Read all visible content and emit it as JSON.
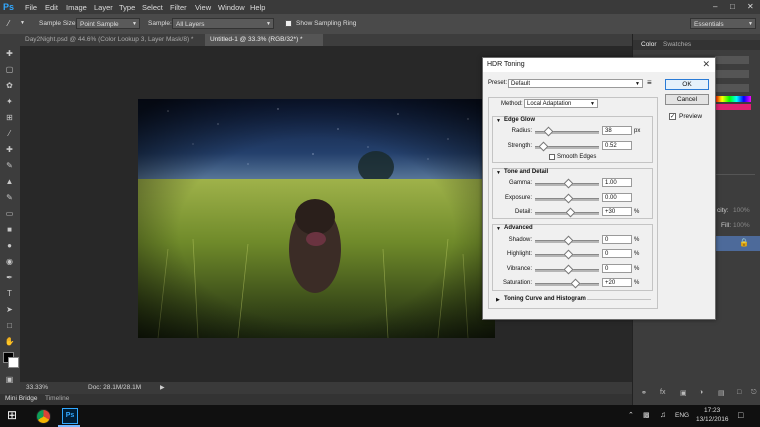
{
  "app": {
    "logo": "Ps",
    "menu": [
      "File",
      "Edit",
      "Image",
      "Layer",
      "Type",
      "Select",
      "Filter",
      "View",
      "Window",
      "Help"
    ]
  },
  "options": {
    "sample_size_label": "Sample Size:",
    "sample_size_value": "Point Sample",
    "sample_label": "Sample:",
    "sample_value": "All Layers",
    "show_ring_label": "Show Sampling Ring",
    "workspace": "Essentials"
  },
  "tabs": [
    "Day2Night.psd @ 44.6% (Color Lookup 3, Layer Mask/8) *",
    "Untitled-1 @ 33.3% (RGB/32*) *"
  ],
  "status": {
    "zoom": "33.33%",
    "doc": "Doc: 28.1M/28.1M"
  },
  "bottom_tabs": [
    "Mini Bridge",
    "Timeline"
  ],
  "panels": {
    "color_tab": "Color",
    "swatches_tab": "Swatches",
    "opacity_partial": "city:",
    "fill_partial": "Fill:",
    "opacity_value": "100%",
    "fill_value": "100%"
  },
  "dialog": {
    "title": "HDR Toning",
    "preset_label": "Preset:",
    "preset_value": "Default",
    "method_label": "Method:",
    "method_value": "Local Adaptation",
    "ok": "OK",
    "cancel": "Cancel",
    "preview_label": "Preview",
    "edge_glow": {
      "title": "Edge Glow",
      "radius_label": "Radius:",
      "radius": "38",
      "radius_unit": "px",
      "strength_label": "Strength:",
      "strength": "0.52",
      "smooth_label": "Smooth Edges"
    },
    "tone_detail": {
      "title": "Tone and Detail",
      "gamma_label": "Gamma:",
      "gamma": "1.00",
      "exposure_label": "Exposure:",
      "exposure": "0.00",
      "detail_label": "Detail:",
      "detail": "+30",
      "detail_unit": "%"
    },
    "advanced": {
      "title": "Advanced",
      "shadow_label": "Shadow:",
      "shadow": "0",
      "highlight_label": "Highlight:",
      "highlight": "0",
      "vibrance_label": "Vibrance:",
      "vibrance": "0",
      "saturation_label": "Saturation:",
      "saturation": "+20",
      "pct": "%"
    },
    "curve_label": "Toning Curve and Histogram"
  },
  "taskbar": {
    "lang": "ENG",
    "time": "17:23",
    "date": "13/12/2016"
  },
  "colors": {
    "ps_blue": "#31a8ff",
    "dialog_bg": "#f0f0f0",
    "default_button_border": "#2a7bd6"
  }
}
